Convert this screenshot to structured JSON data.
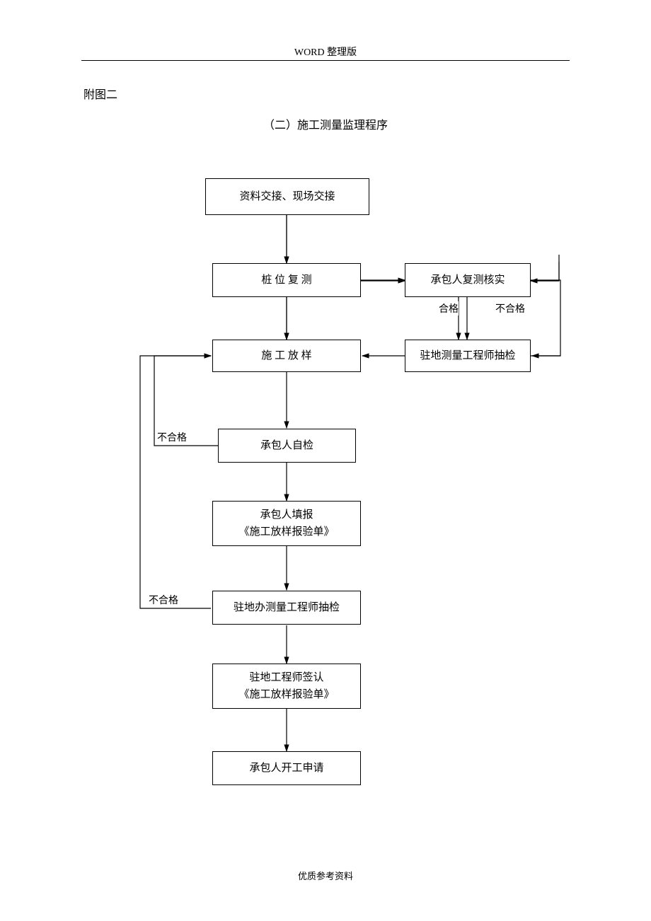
{
  "header": {
    "text": "WORD 整理版"
  },
  "appendix": {
    "label": "附图二"
  },
  "title": "（二）施工测量监理程序",
  "footer": {
    "text": "优质参考资料"
  },
  "nodes": {
    "n1": "资料交接、现场交接",
    "n2": "桩  位  复  测",
    "n3": "承包人复测核实",
    "n4": "施  工  放  样",
    "n5": "驻地测量工程师抽检",
    "n6": "承包人自检",
    "n7_line1": "承包人填报",
    "n7_line2": "《施工放样报验单》",
    "n8": "驻地办测量工程师抽检",
    "n9_line1": "驻地工程师签认",
    "n9_line2": "《施工放样报验单》",
    "n10": "承包人开工申请"
  },
  "edge_labels": {
    "e_n3_pass": "合格",
    "e_n3_fail": "不合格",
    "e_n6_fail": "不合格",
    "e_n8_fail": "不合格"
  },
  "chart_data": {
    "type": "flowchart",
    "title": "（二）施工测量监理程序",
    "nodes": [
      {
        "id": "n1",
        "label": "资料交接、现场交接"
      },
      {
        "id": "n2",
        "label": "桩位复测"
      },
      {
        "id": "n3",
        "label": "承包人复测核实"
      },
      {
        "id": "n4",
        "label": "施工放样"
      },
      {
        "id": "n5",
        "label": "驻地测量工程师抽检"
      },
      {
        "id": "n6",
        "label": "承包人自检"
      },
      {
        "id": "n7",
        "label": "承包人填报《施工放样报验单》"
      },
      {
        "id": "n8",
        "label": "驻地办测量工程师抽检"
      },
      {
        "id": "n9",
        "label": "驻地工程师签认《施工放样报验单》"
      },
      {
        "id": "n10",
        "label": "承包人开工申请"
      }
    ],
    "edges": [
      {
        "from": "n1",
        "to": "n2",
        "label": ""
      },
      {
        "from": "n2",
        "to": "n3",
        "label": ""
      },
      {
        "from": "n2",
        "to": "n4",
        "label": ""
      },
      {
        "from": "n3",
        "to": "n5",
        "label": "合格"
      },
      {
        "from": "n3",
        "to": "n3",
        "label": "不合格"
      },
      {
        "from": "n5",
        "to": "n4",
        "label": ""
      },
      {
        "from": "n4",
        "to": "n6",
        "label": ""
      },
      {
        "from": "n6",
        "to": "n4",
        "label": "不合格"
      },
      {
        "from": "n6",
        "to": "n7",
        "label": ""
      },
      {
        "from": "n7",
        "to": "n8",
        "label": ""
      },
      {
        "from": "n8",
        "to": "n4",
        "label": "不合格"
      },
      {
        "from": "n8",
        "to": "n9",
        "label": ""
      },
      {
        "from": "n9",
        "to": "n10",
        "label": ""
      }
    ]
  }
}
